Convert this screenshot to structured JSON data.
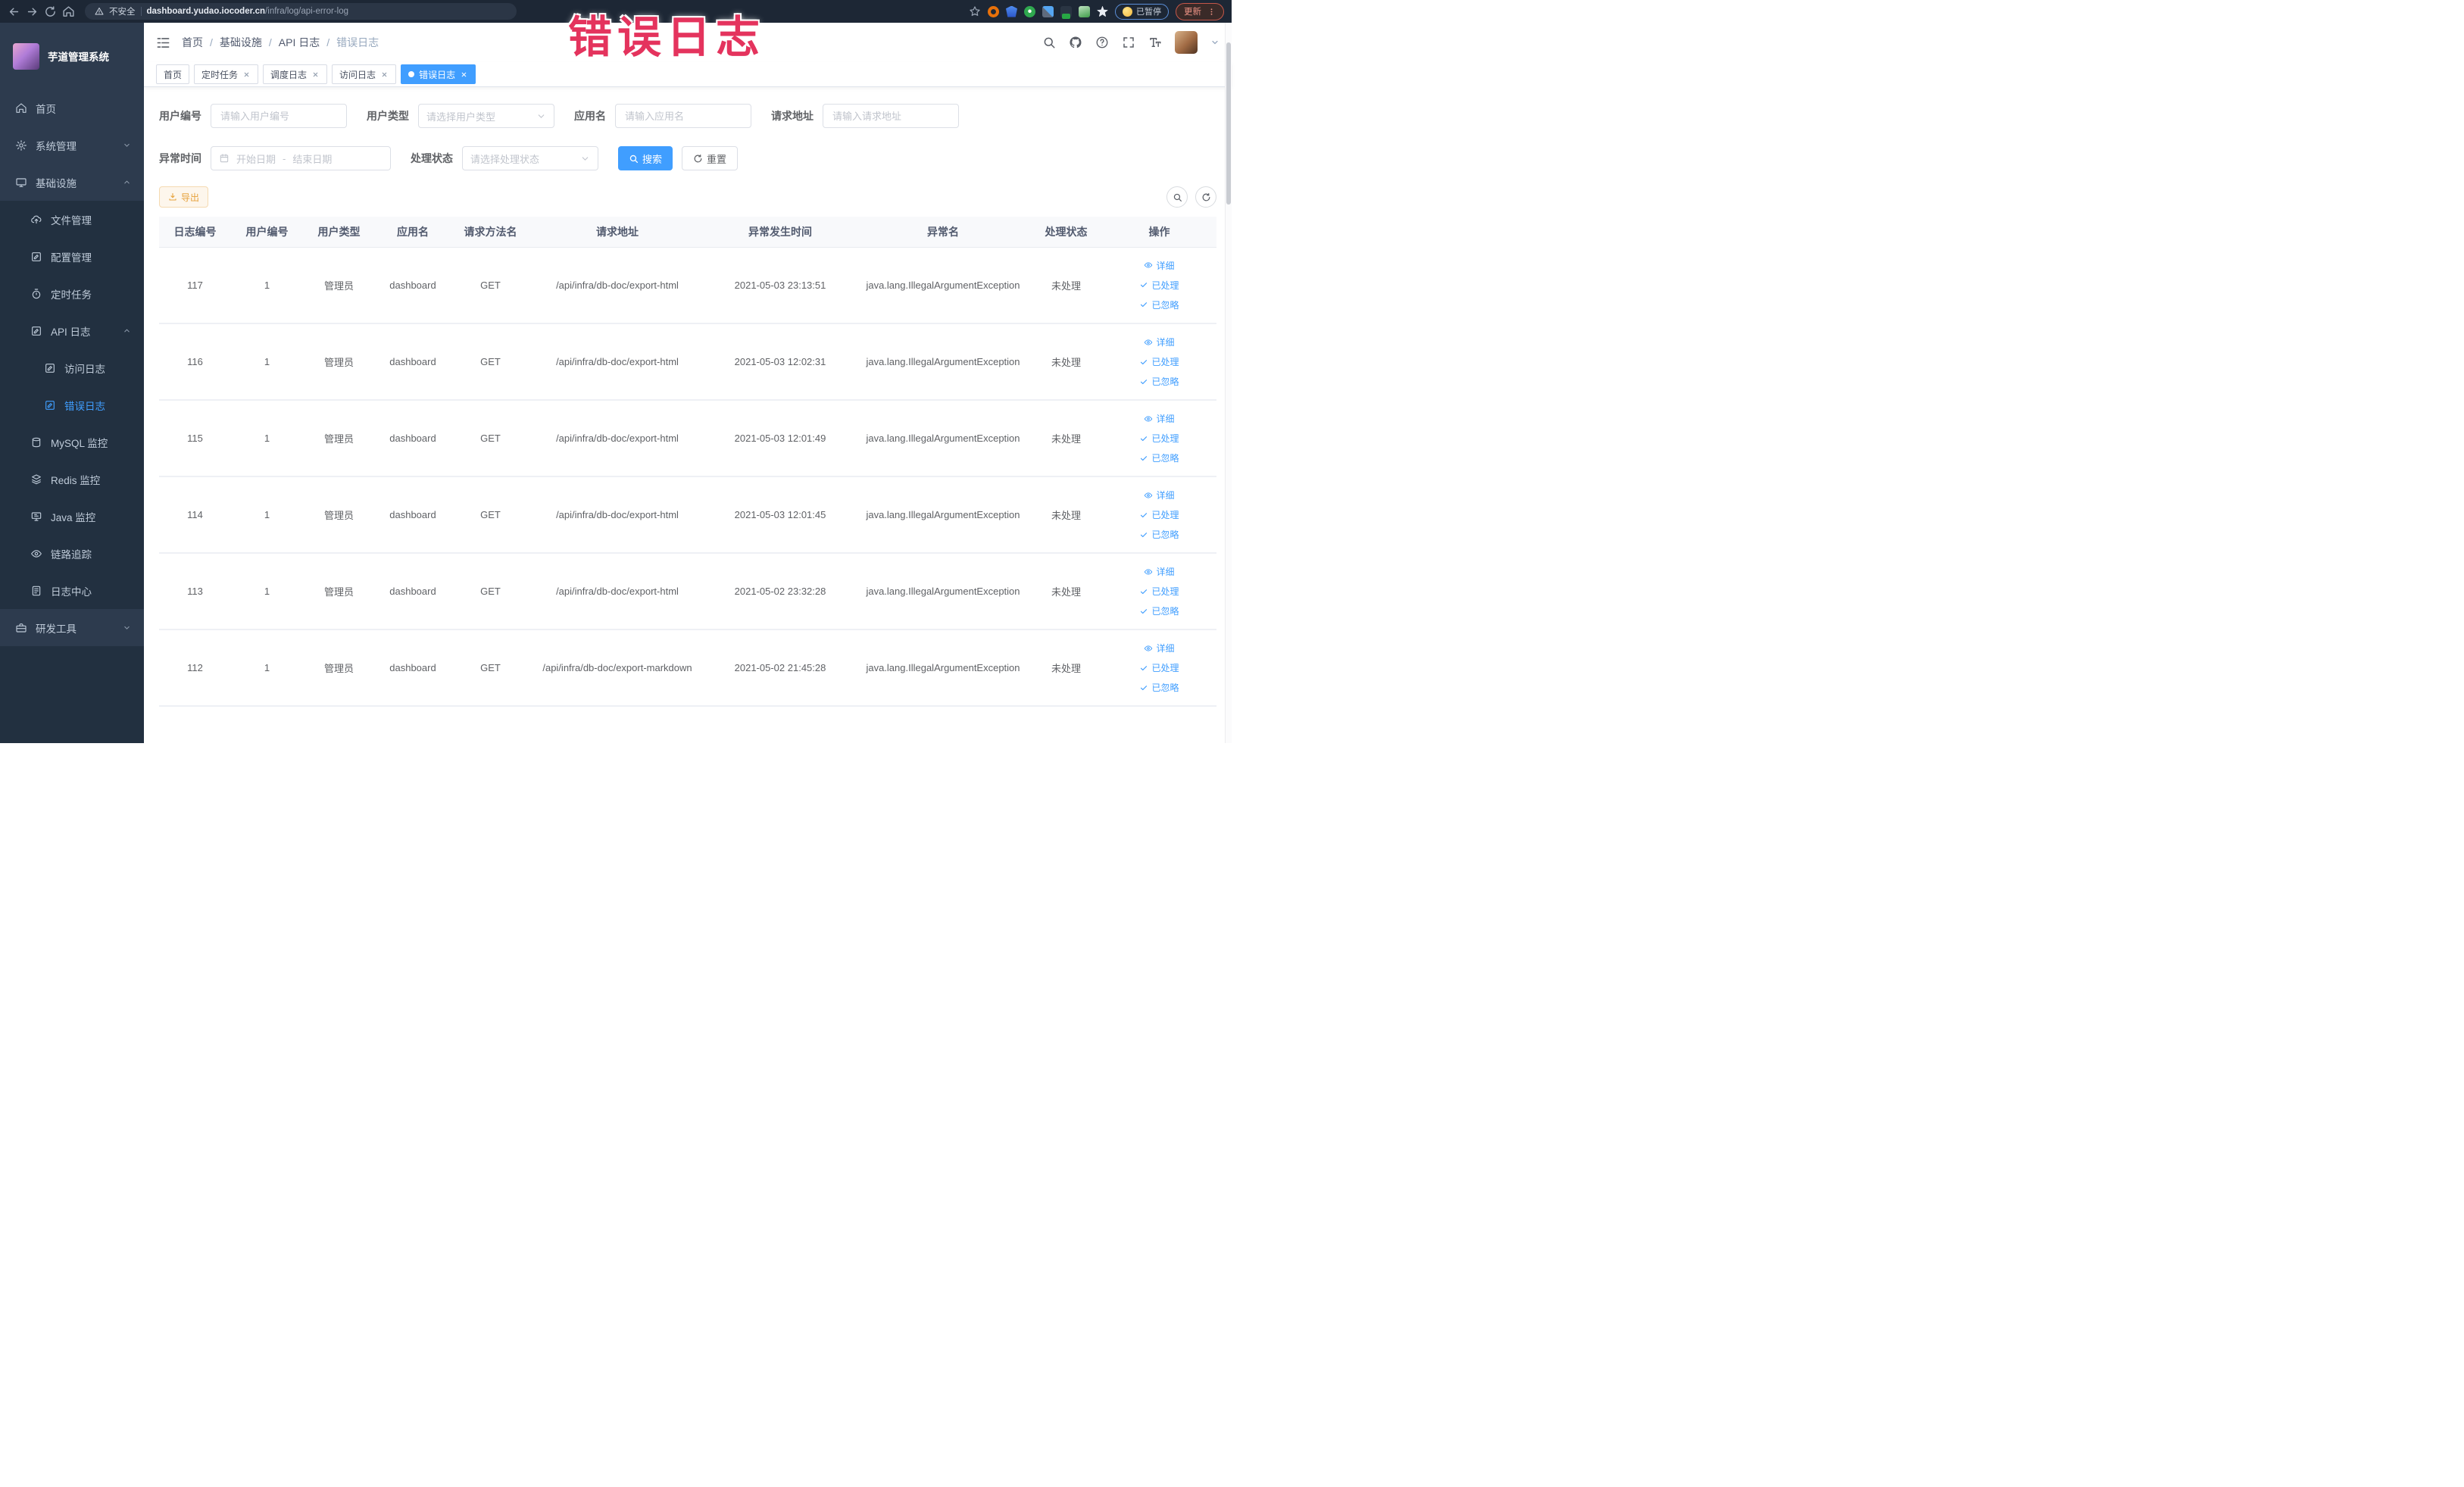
{
  "browser": {
    "security_label": "不安全",
    "url_domain": "dashboard.yudao.iocoder.cn",
    "url_path": "/infra/log/api-error-log",
    "paused_label": "已暂停",
    "update_label": "更新"
  },
  "overlay": {
    "title": "错误日志",
    "color": "#e4335d"
  },
  "sidebar": {
    "app_title": "芋道管理系统",
    "items": [
      {
        "key": "home",
        "label": "首页",
        "icon": "home-icon",
        "level": 0
      },
      {
        "key": "system-management",
        "label": "系统管理",
        "icon": "gear-icon",
        "level": 0,
        "chevron": "down"
      },
      {
        "key": "infrastructure",
        "label": "基础设施",
        "icon": "infra-icon",
        "level": 0,
        "chevron": "up"
      },
      {
        "key": "file-management",
        "label": "文件管理",
        "icon": "cloud-upload-icon",
        "level": 1
      },
      {
        "key": "config-management",
        "label": "配置管理",
        "icon": "edit-icon",
        "level": 1
      },
      {
        "key": "timed-task",
        "label": "定时任务",
        "icon": "timer-icon",
        "level": 1
      },
      {
        "key": "api-log",
        "label": "API 日志",
        "icon": "api-log-icon",
        "level": 1,
        "chevron": "up"
      },
      {
        "key": "access-log",
        "label": "访问日志",
        "icon": "access-log-icon",
        "level": 2
      },
      {
        "key": "error-log",
        "label": "错误日志",
        "icon": "error-log-icon",
        "level": 2,
        "active": true
      },
      {
        "key": "mysql-monitor",
        "label": "MySQL 监控",
        "icon": "mysql-icon",
        "level": 1
      },
      {
        "key": "redis-monitor",
        "label": "Redis 监控",
        "icon": "redis-icon",
        "level": 1
      },
      {
        "key": "java-monitor",
        "label": "Java 监控",
        "icon": "java-icon",
        "level": 1
      },
      {
        "key": "trace",
        "label": "链路追踪",
        "icon": "trace-icon",
        "level": 1
      },
      {
        "key": "log-center",
        "label": "日志中心",
        "icon": "log-center-icon",
        "level": 1
      },
      {
        "key": "dev-tools",
        "label": "研发工具",
        "icon": "tools-icon",
        "level": 0,
        "chevron": "down"
      }
    ]
  },
  "navbar": {
    "breadcrumb": [
      "首页",
      "基础设施",
      "API 日志",
      "错误日志"
    ],
    "breadcrumb_separator": "/"
  },
  "tabs": [
    {
      "key": "home",
      "label": "首页"
    },
    {
      "key": "timed-task",
      "label": "定时任务",
      "closable": true
    },
    {
      "key": "schedule-log",
      "label": "调度日志",
      "closable": true
    },
    {
      "key": "access-log",
      "label": "访问日志",
      "closable": true
    },
    {
      "key": "error-log",
      "label": "错误日志",
      "closable": true,
      "active": true
    }
  ],
  "filters": {
    "user_id_label": "用户编号",
    "user_id_placeholder": "请输入用户编号",
    "user_type_label": "用户类型",
    "user_type_placeholder": "请选择用户类型",
    "app_name_label": "应用名",
    "app_name_placeholder": "请输入应用名",
    "request_url_label": "请求地址",
    "request_url_placeholder": "请输入请求地址",
    "exception_time_label": "异常时间",
    "date_start_placeholder": "开始日期",
    "date_separator": "-",
    "date_end_placeholder": "结束日期",
    "process_status_label": "处理状态",
    "process_status_placeholder": "请选择处理状态",
    "search_label": "搜索",
    "reset_label": "重置"
  },
  "toolbar": {
    "export_label": "导出"
  },
  "table": {
    "columns": [
      "日志编号",
      "用户编号",
      "用户类型",
      "应用名",
      "请求方法名",
      "请求地址",
      "异常发生时间",
      "异常名",
      "处理状态",
      "操作"
    ],
    "actions": [
      "详细",
      "已处理",
      "已忽略"
    ],
    "rows": [
      [
        "117",
        "1",
        "管理员",
        "dashboard",
        "GET",
        "/api/infra/db-doc/export-html",
        "2021-05-03 23:13:51",
        "java.lang.IllegalArgumentException",
        "未处理"
      ],
      [
        "116",
        "1",
        "管理员",
        "dashboard",
        "GET",
        "/api/infra/db-doc/export-html",
        "2021-05-03 12:02:31",
        "java.lang.IllegalArgumentException",
        "未处理"
      ],
      [
        "115",
        "1",
        "管理员",
        "dashboard",
        "GET",
        "/api/infra/db-doc/export-html",
        "2021-05-03 12:01:49",
        "java.lang.IllegalArgumentException",
        "未处理"
      ],
      [
        "114",
        "1",
        "管理员",
        "dashboard",
        "GET",
        "/api/infra/db-doc/export-html",
        "2021-05-03 12:01:45",
        "java.lang.IllegalArgumentException",
        "未处理"
      ],
      [
        "113",
        "1",
        "管理员",
        "dashboard",
        "GET",
        "/api/infra/db-doc/export-html",
        "2021-05-02 23:32:28",
        "java.lang.IllegalArgumentException",
        "未处理"
      ],
      [
        "112",
        "1",
        "管理员",
        "dashboard",
        "GET",
        "/api/infra/db-doc/export-markdown",
        "2021-05-02 21:45:28",
        "java.lang.IllegalArgumentException",
        "未处理"
      ]
    ]
  }
}
